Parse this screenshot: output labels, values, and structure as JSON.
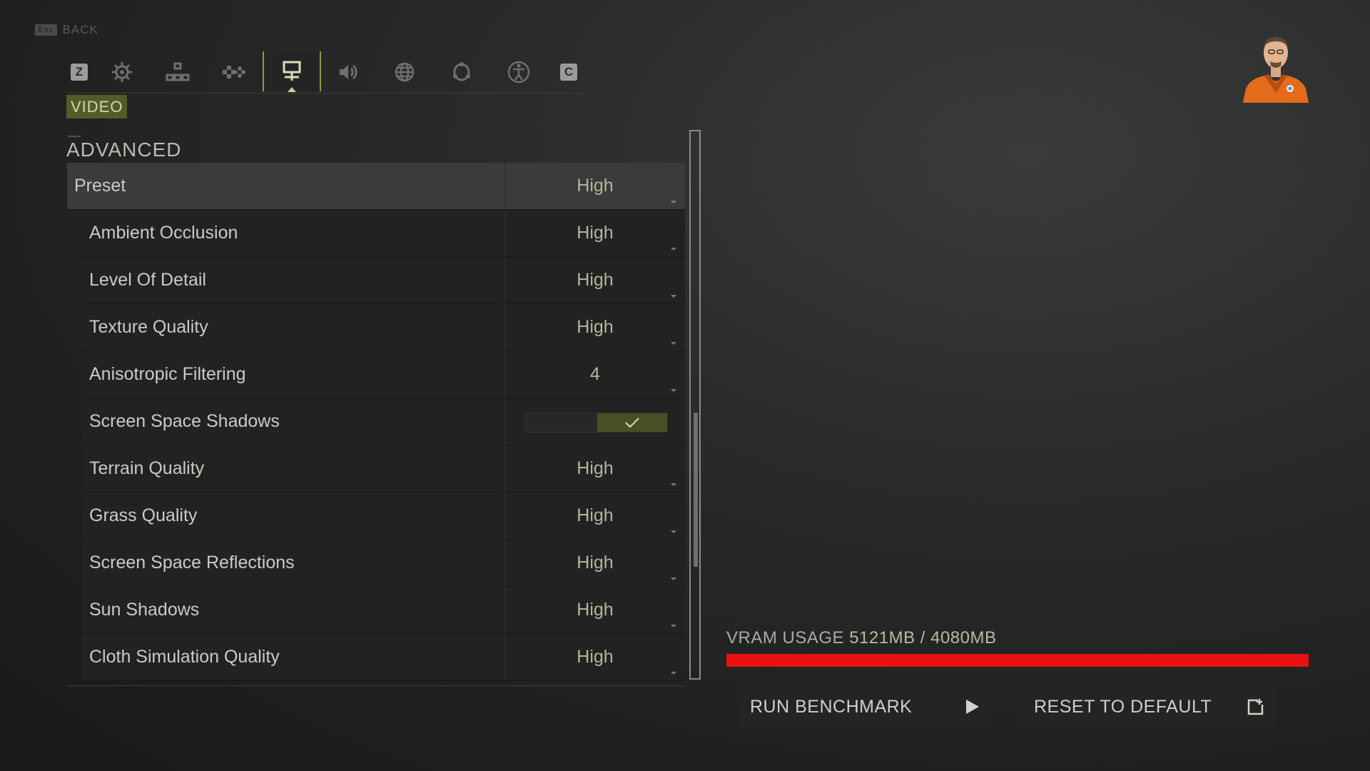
{
  "nav": {
    "back_key": "Esc",
    "back_label": "BACK",
    "left_key": "Z",
    "right_key": "C",
    "tabs": [
      {
        "icon": "gear-icon"
      },
      {
        "icon": "network-icon"
      },
      {
        "icon": "gamepad-dpad-icon"
      },
      {
        "icon": "monitor-icon",
        "active": true
      },
      {
        "icon": "speaker-icon"
      },
      {
        "icon": "globe-icon"
      },
      {
        "icon": "social-icon"
      },
      {
        "icon": "accessibility-icon"
      }
    ],
    "active_tab_label": "VIDEO"
  },
  "section": {
    "title": "ADVANCED",
    "rows": [
      {
        "label": "Preset",
        "value": "High"
      },
      {
        "label": "Ambient Occlusion",
        "value": "High"
      },
      {
        "label": "Level Of Detail",
        "value": "High"
      },
      {
        "label": "Texture Quality",
        "value": "High"
      },
      {
        "label": "Anisotropic Filtering",
        "value": "4"
      },
      {
        "label": "Screen Space Shadows",
        "toggle": true
      },
      {
        "label": "Terrain Quality",
        "value": "High"
      },
      {
        "label": "Grass Quality",
        "value": "High"
      },
      {
        "label": "Screen Space Reflections",
        "value": "High"
      },
      {
        "label": "Sun Shadows",
        "value": "High"
      },
      {
        "label": "Cloth Simulation Quality",
        "value": "High"
      }
    ]
  },
  "vram": {
    "label": "VRAM USAGE",
    "value": "5121MB / 4080MB",
    "usage_fraction": 1.0
  },
  "buttons": {
    "benchmark": "RUN BENCHMARK",
    "reset": "RESET TO DEFAULT"
  },
  "colors": {
    "accent": "#8f9a40",
    "vram_bar": "#e81010",
    "tag_bg": "#535b2a"
  }
}
